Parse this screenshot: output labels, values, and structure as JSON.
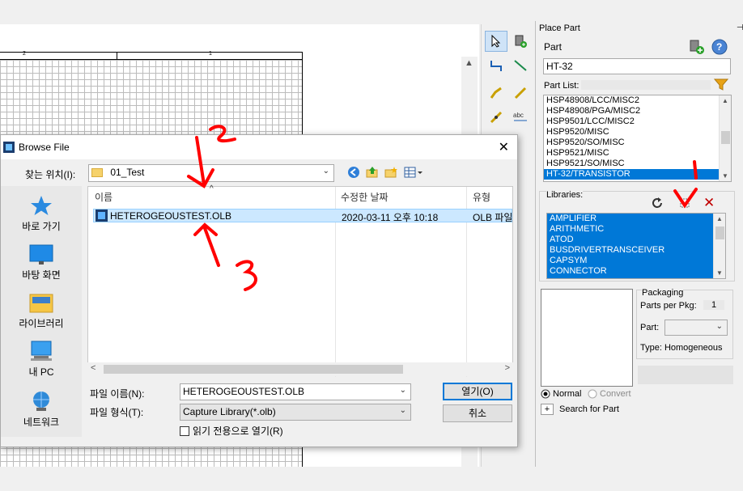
{
  "canvas": {
    "ruler_labels": [
      "2",
      "1"
    ]
  },
  "panel": {
    "title": "Place Part",
    "part_label": "Part",
    "part_value": "HT-32",
    "part_list_label": "Part List:",
    "part_list": [
      "HSP48908/LCC/MISC2",
      "HSP48908/PGA/MISC2",
      "HSP9501/LCC/MISC2",
      "HSP9520/MISC",
      "HSP9520/SO/MISC",
      "HSP9521/MISC",
      "HSP9521/SO/MISC",
      "HT-32/TRANSISTOR"
    ],
    "part_list_selected": "HT-32/TRANSISTOR",
    "libraries_label": "Libraries:",
    "libraries": [
      "AMPLIFIER",
      "ARITHMETIC",
      "ATOD",
      "BUSDRIVERTRANSCEIVER",
      "CAPSYM",
      "CONNECTOR"
    ],
    "packaging_label": "Packaging",
    "parts_per_pkg_label": "Parts per Pkg:",
    "parts_per_pkg_value": "1",
    "part_label2": "Part:",
    "type_text": "Type: Homogeneous",
    "radio_normal": "Normal",
    "radio_convert": "Convert",
    "search_label": "Search for Part",
    "search_expander": "+"
  },
  "dialog": {
    "title": "Browse File",
    "look_in_label": "찾는 위치(I):",
    "look_in_value": "01_Test",
    "places": [
      "바로 가기",
      "바탕 화면",
      "라이브러리",
      "내 PC",
      "네트워크"
    ],
    "columns": [
      "이름",
      "수정한 날짜",
      "유형"
    ],
    "file": {
      "name": "HETEROGEOUSTEST.OLB",
      "modified": "2020-03-11 오후 10:18",
      "type": "OLB 파일"
    },
    "filename_label": "파일 이름(N):",
    "filename_value": "HETEROGEOUSTEST.OLB",
    "filetype_label": "파일 형식(T):",
    "filetype_value": "Capture Library(*.olb)",
    "readonly_label": "읽기 전용으로 열기(R)",
    "open_button": "열기(O)",
    "cancel_button": "취소"
  },
  "colors": {
    "selection": "#0078d7",
    "annotation": "#ff0000",
    "row_highlight": "#cce8ff"
  }
}
